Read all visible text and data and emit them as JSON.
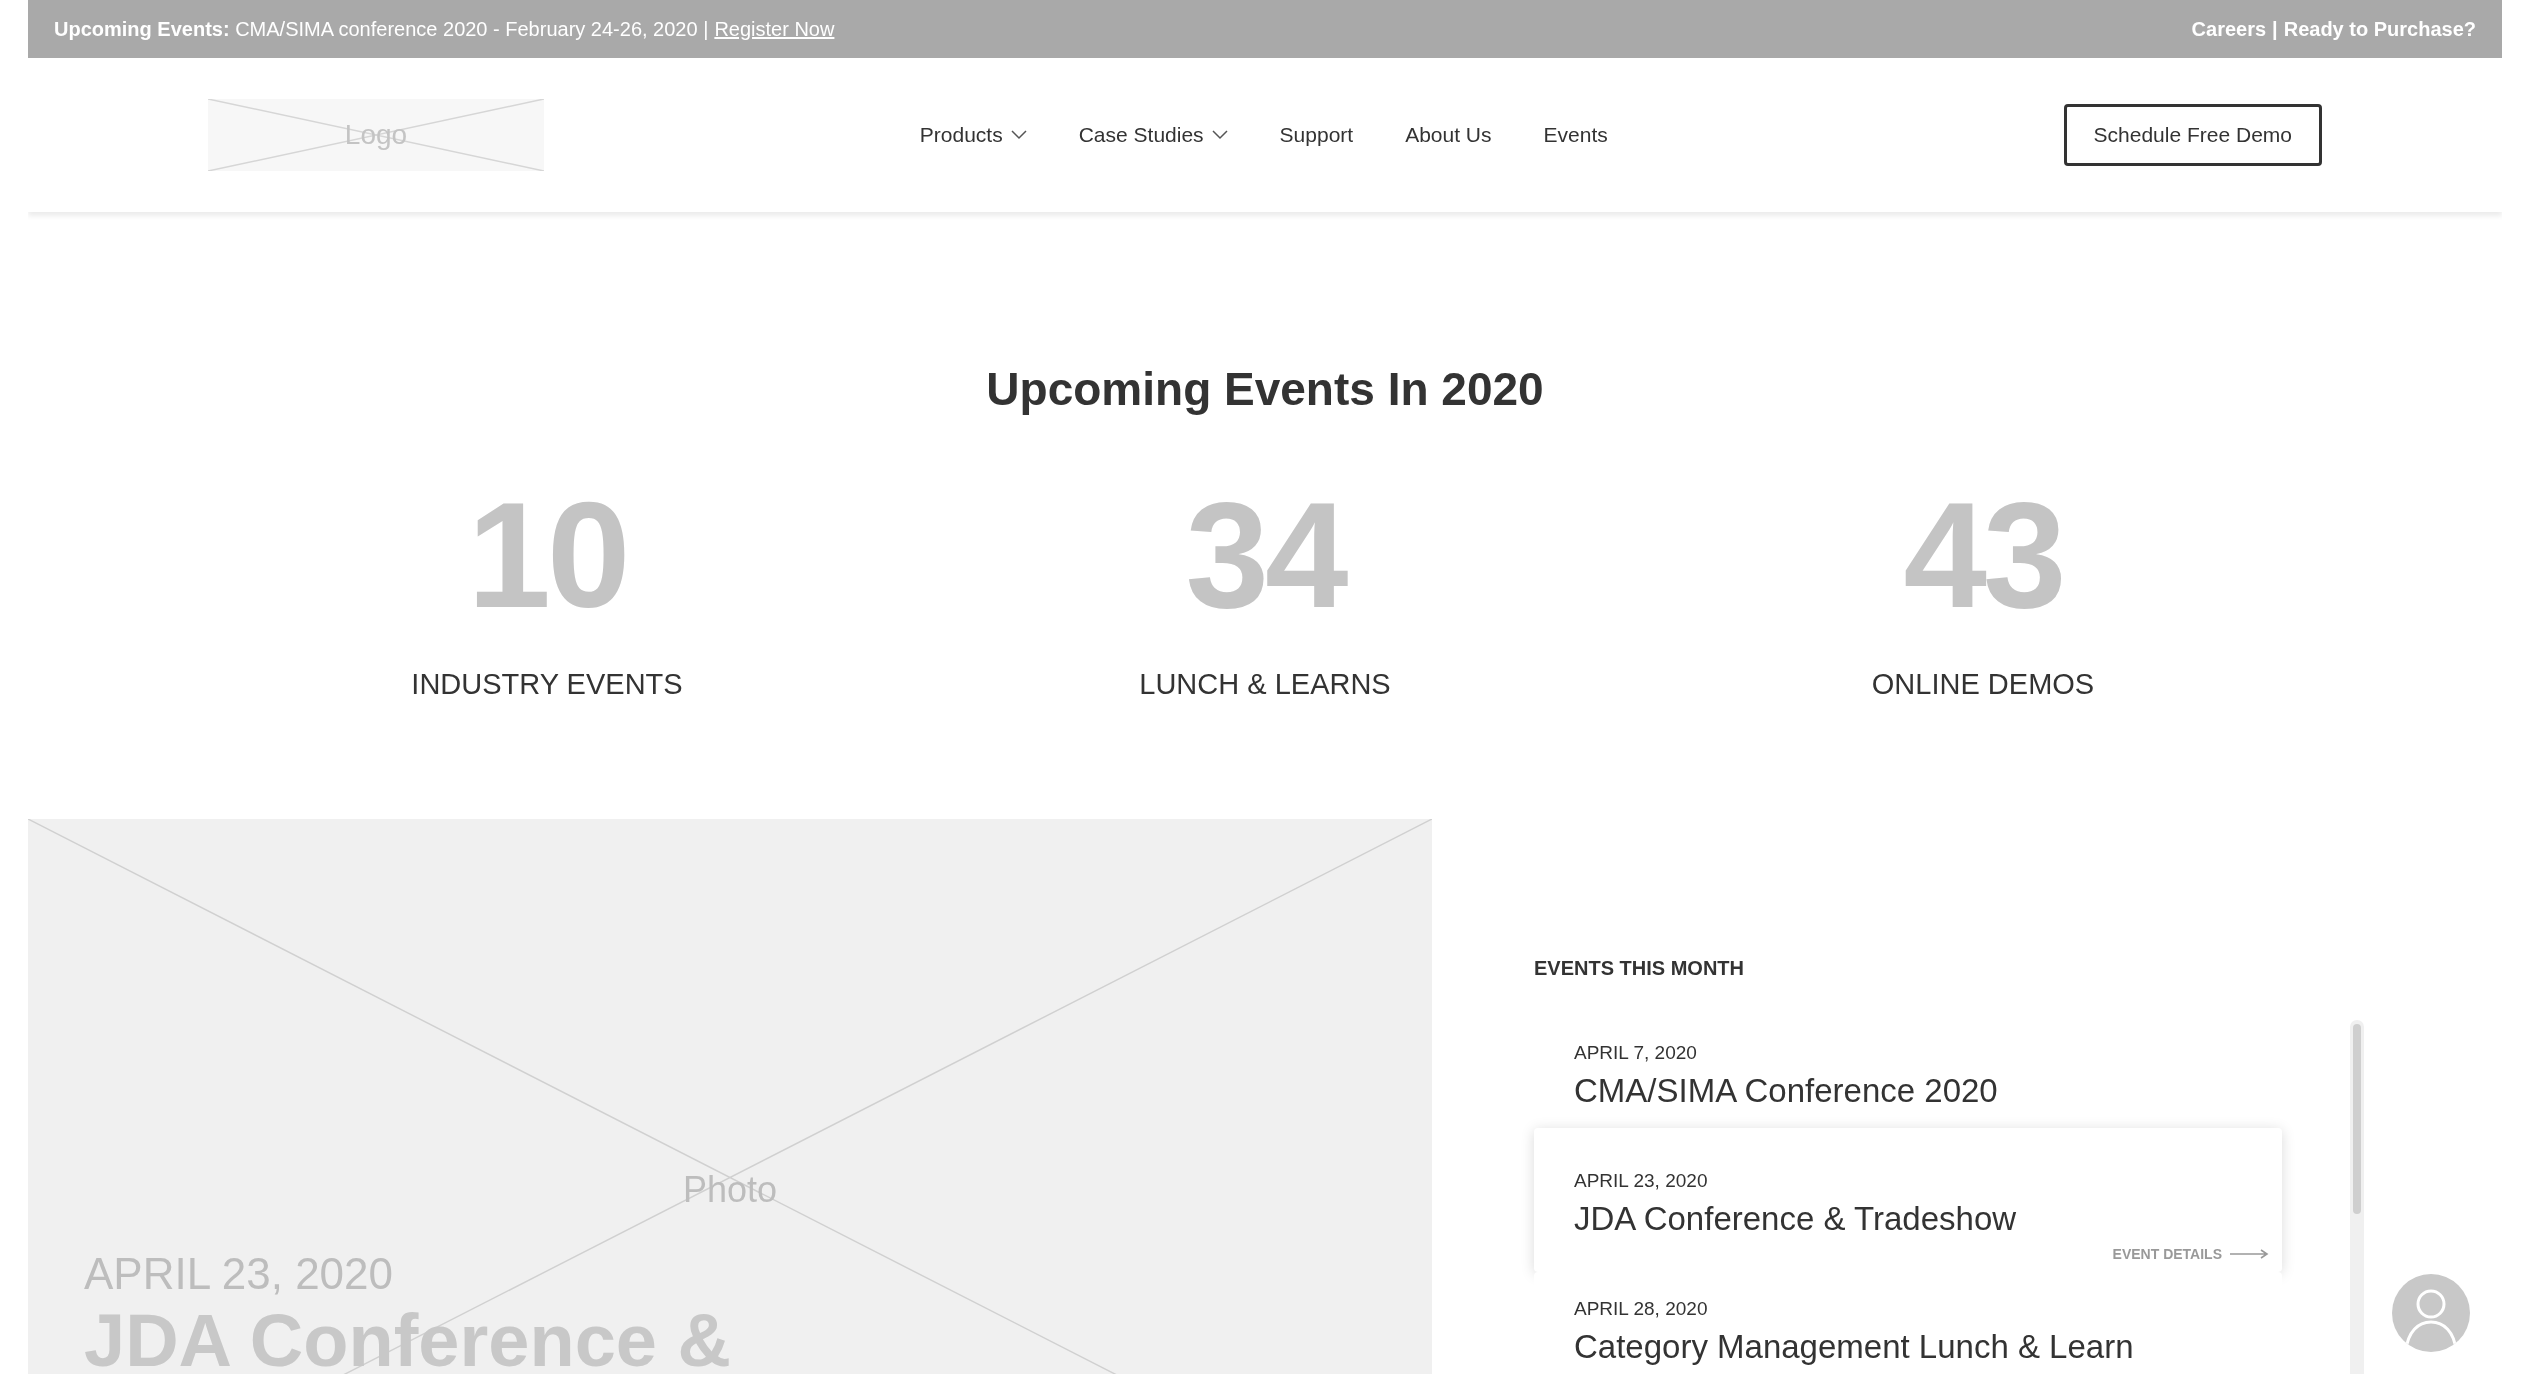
{
  "announcement": {
    "label": "Upcoming Events:",
    "text": "CMA/SIMA conference 2020 - February 24-26, 2020 |",
    "link": "Register Now"
  },
  "top_links": [
    {
      "label": "Careers"
    },
    {
      "label": "Ready to Purchase?"
    }
  ],
  "top_links_separator": "|",
  "logo": {
    "label": "Logo"
  },
  "nav": [
    {
      "label": "Products",
      "dropdown": true
    },
    {
      "label": "Case Studies",
      "dropdown": true
    },
    {
      "label": "Support",
      "dropdown": false
    },
    {
      "label": "About Us",
      "dropdown": false
    },
    {
      "label": "Events",
      "dropdown": false
    }
  ],
  "cta": "Schedule Free Demo",
  "heading": "Upcoming Events In 2020",
  "stats": [
    {
      "value": "10",
      "label": "INDUSTRY EVENTS"
    },
    {
      "value": "34",
      "label": "LUNCH & LEARNS"
    },
    {
      "value": "43",
      "label": "ONLINE DEMOS"
    }
  ],
  "featured": {
    "photo_label": "Photo",
    "date": "APRIL 23, 2020",
    "title": "JDA Conference &"
  },
  "events_section": {
    "title": "EVENTS THIS MONTH",
    "items": [
      {
        "date": "APRIL 7, 2020",
        "title": "CMA/SIMA Conference 2020",
        "selected": false
      },
      {
        "date": "APRIL 23, 2020",
        "title": "JDA Conference & Tradeshow",
        "selected": true,
        "details_link": "EVENT DETAILS"
      },
      {
        "date": "APRIL 28, 2020",
        "title": "Category Management Lunch & Learn",
        "selected": false
      }
    ]
  }
}
